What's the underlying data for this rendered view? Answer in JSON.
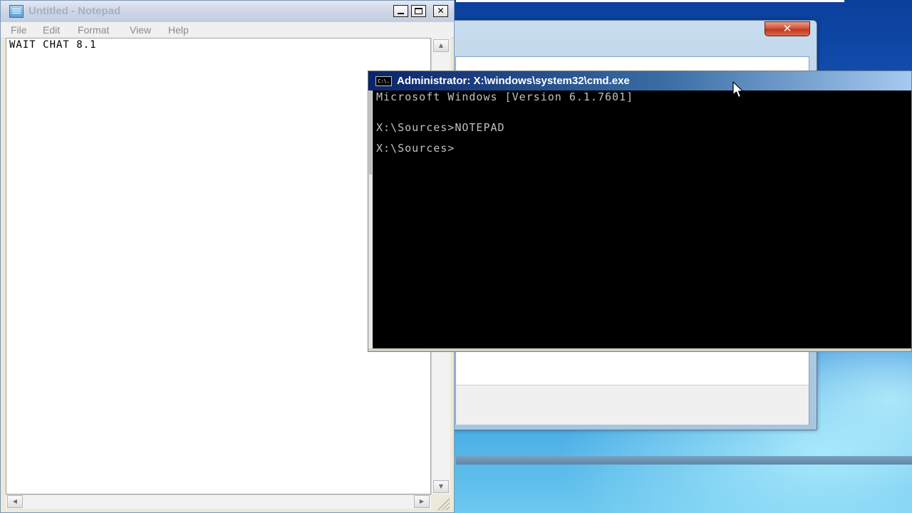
{
  "notepad": {
    "title": "Untitled - Notepad",
    "menu": [
      "File",
      "Edit",
      "Format",
      "View",
      "Help"
    ],
    "content": "WAIT CHAT 8.1"
  },
  "cmd": {
    "title": "Administrator: X:\\windows\\system32\\cmd.exe",
    "icon_label": "C:\\.",
    "lines": [
      "Microsoft Windows [Version 6.1.7601]",
      "X:\\Sources>NOTEPAD",
      "X:\\Sources>"
    ]
  },
  "setup": {
    "close_glyph": "✕"
  },
  "icons": {
    "notepad_icon": "notepad-icon",
    "cmd_icon": "cmd-icon",
    "cursor": "mouse-pointer-icon"
  },
  "colors": {
    "console_bg": "#000000",
    "console_text": "#c0c0c0",
    "cmd_title_start": "#0a246a"
  }
}
